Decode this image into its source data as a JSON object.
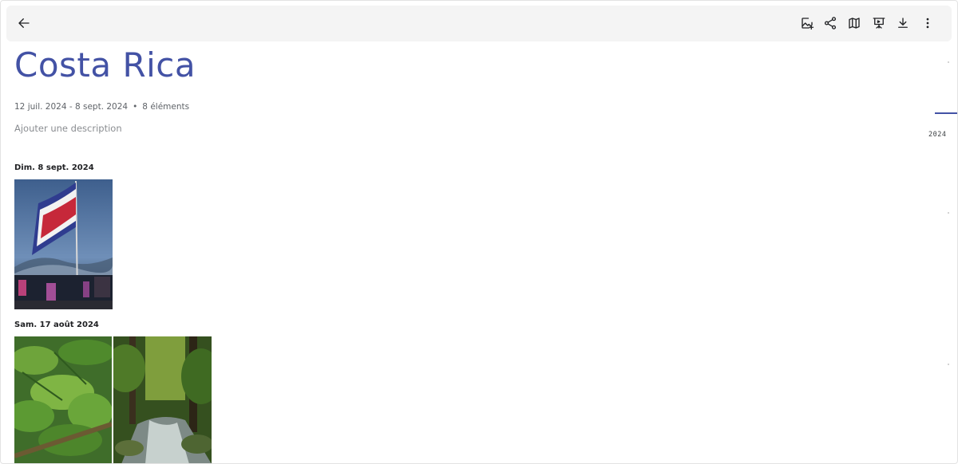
{
  "album": {
    "title": "Costa Rica",
    "date_range": "12 juil. 2024 - 8 sept. 2024",
    "separator": "•",
    "item_count": "8 éléments",
    "description_placeholder": "Ajouter une description"
  },
  "toolbar": {
    "back": "arrow-back-icon",
    "actions": [
      "add-photos-icon",
      "share-icon",
      "map-icon",
      "slideshow-icon",
      "download-icon",
      "more-vert-icon"
    ]
  },
  "sections": [
    {
      "date": "Dim. 8 sept. 2024",
      "photos": [
        "costa-rica-flag-photo"
      ]
    },
    {
      "date": "Sam. 17 août 2024",
      "photos": [
        "jungle-plants-photo",
        "forest-stream-photo"
      ]
    }
  ],
  "scrubber": {
    "year": "2024"
  },
  "colors": {
    "accent": "#4352a5",
    "toolbar_bg": "#f4f4f4"
  }
}
